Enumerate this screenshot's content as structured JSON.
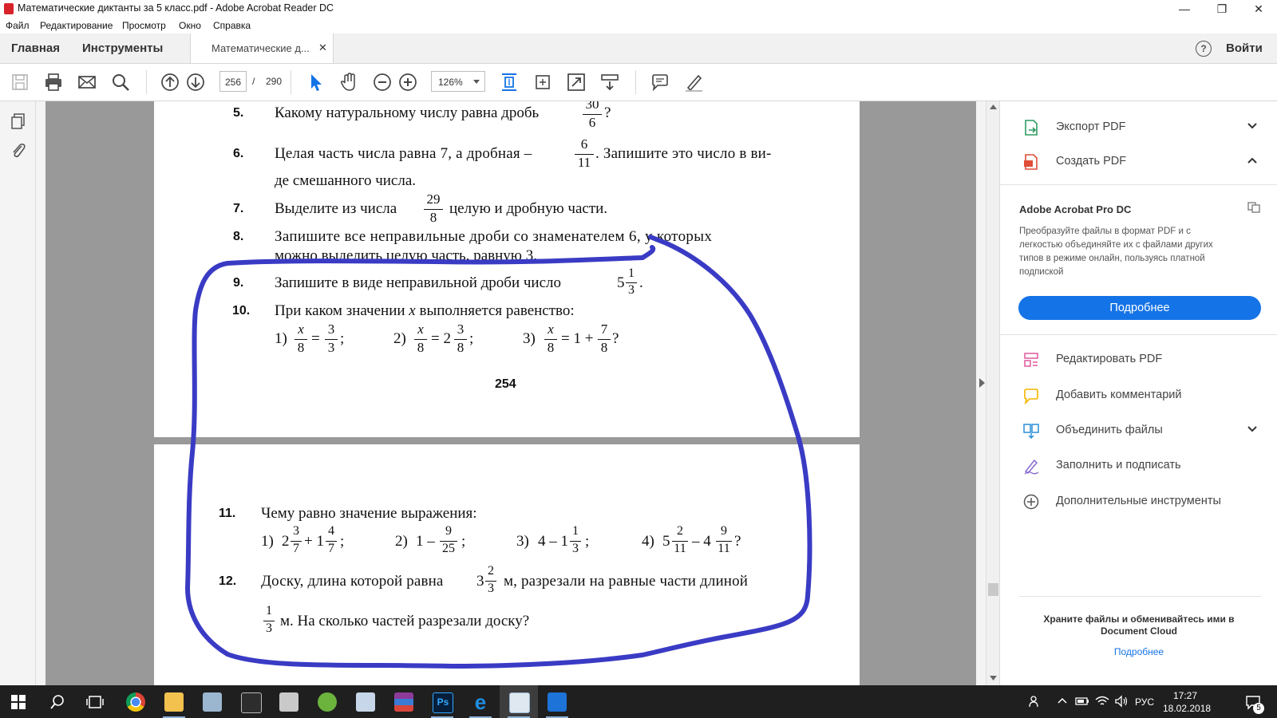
{
  "window": {
    "title": "Математические диктанты за 5 класс.pdf - Adobe Acrobat Reader DC",
    "minimize": "—",
    "maximize": "❐",
    "close": "✕"
  },
  "menu": [
    "Файл",
    "Редактирование",
    "Просмотр",
    "Окно",
    "Справка"
  ],
  "tabs": {
    "home": "Главная",
    "tools": "Инструменты",
    "document": "Математические д...",
    "close": "✕",
    "help": "?",
    "login": "Войти"
  },
  "toolbar": {
    "current_page": "256",
    "separator": "/",
    "total_pages": "290",
    "zoom": "126%"
  },
  "document": {
    "page_number": "254",
    "problems": {
      "p5": {
        "num": "5.",
        "text": "Какому натуральному числу равна дробь",
        "frac_num": "30",
        "frac_den": "6",
        "end": "?"
      },
      "p6": {
        "num": "6.",
        "text_a": "Целая часть числа равна 7, а дробная –",
        "frac_num": "6",
        "frac_den": "11",
        "text_b": ". Запишите это число в ви-",
        "line2": "де смешанного числа."
      },
      "p7": {
        "num": "7.",
        "text_a": "Выделите из числа",
        "frac_num": "29",
        "frac_den": "8",
        "text_b": "целую и дробную части."
      },
      "p8": {
        "num": "8.",
        "line1": "Запишите все неправильные дроби со знаменателем 6, у которых",
        "line2": "можно выделить целую часть, равную 3."
      },
      "p9": {
        "num": "9.",
        "text": "Запишите в виде неправильной дроби число",
        "whole": "5",
        "frac_num": "1",
        "frac_den": "3",
        "end": "."
      },
      "p10": {
        "num": "10.",
        "text_a": "При каком значении ",
        "var": "x",
        "text_b": " выполняется равенство:",
        "items": [
          {
            "label": "1)",
            "n1": "x",
            "d1": "8",
            "op": "=",
            "w2": "",
            "n2": "3",
            "d2": "3",
            "end": ";"
          },
          {
            "label": "2)",
            "n1": "x",
            "d1": "8",
            "op": "= 2",
            "w2": "",
            "n2": "3",
            "d2": "8",
            "end": ";"
          },
          {
            "label": "3)",
            "n1": "x",
            "d1": "8",
            "op": "= 1 +",
            "w2": "",
            "n2": "7",
            "d2": "8",
            "end": "?"
          }
        ]
      },
      "p11": {
        "num": "11.",
        "text": "Чему равно значение выражения:",
        "items": [
          {
            "label": "1)",
            "w1": "2",
            "n1": "3",
            "d1": "7",
            "op": "+ 1",
            "n2": "4",
            "d2": "7",
            "end": ";"
          },
          {
            "label": "2)",
            "w1": "1 –",
            "n1": "9",
            "d1": "25",
            "op": "",
            "n2": "",
            "d2": "",
            "end": ";"
          },
          {
            "label": "3)",
            "w1": "4 – 1",
            "n1": "1",
            "d1": "3",
            "op": "",
            "n2": "",
            "d2": "",
            "end": ";"
          },
          {
            "label": "4)",
            "w1": "5",
            "n1": "2",
            "d1": "11",
            "op": "– 4",
            "n2": "9",
            "d2": "11",
            "end": "?"
          }
        ]
      },
      "p12": {
        "num": "12.",
        "text_a": "Доску, длина которой равна",
        "whole": "3",
        "frac_num": "2",
        "frac_den": "3",
        "text_b": "м, разрезали на равные части длиной",
        "frac2_num": "1",
        "frac2_den": "3",
        "line2": "м. На сколько частей разрезали доску?"
      }
    }
  },
  "right_panel": {
    "export_pdf": "Экспорт PDF",
    "create_pdf": "Создать PDF",
    "promo_title": "Adobe Acrobat Pro DC",
    "promo_text": [
      "Преобразуйте файлы в формат PDF и с",
      "легкостью объединяйте их с файлами других",
      "типов в режиме онлайн, пользуясь платной",
      "подпиской"
    ],
    "promo_button": "Подробнее",
    "edit_pdf": "Редактировать PDF",
    "add_comment": "Добавить комментарий",
    "combine_files": "Объединить файлы",
    "fill_sign": "Заполнить и подписать",
    "more_tools": "Дополнительные инструменты",
    "cloud_text": [
      "Храните файлы и обменивайтесь ими в",
      "Document Cloud"
    ],
    "cloud_link": "Подробнее"
  },
  "taskbar": {
    "lang": "РУС",
    "time": "17:27",
    "date": "18.02.2018",
    "notifications": "5"
  },
  "colors": {
    "adobe_blue": "#1473e6",
    "annotation": "#3a3bc4",
    "taskbar": "#1f1f1f"
  }
}
